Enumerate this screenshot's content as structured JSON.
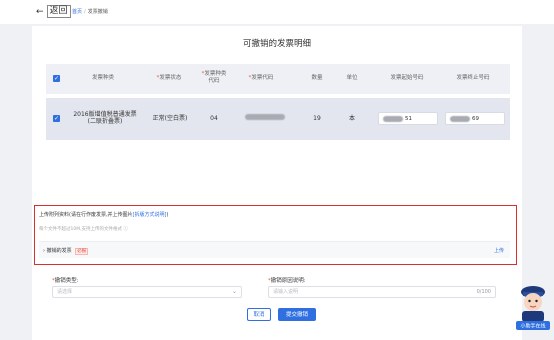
{
  "header": {
    "back_label": "返回",
    "back_arrow": "←",
    "breadcrumb_home": "首页",
    "breadcrumb_sep": "/",
    "breadcrumb_current": "发票撤销"
  },
  "page_title": "可撤销的发票明细",
  "table": {
    "headers": {
      "type": "发票种类",
      "status": "发票状态",
      "type_code": "发票种类代码",
      "invoice_code": "发票代码",
      "quantity": "数量",
      "unit": "单位",
      "start_no": "发票起始号码",
      "end_no": "发票终止号码"
    },
    "row": {
      "type": "2016版增值税普通发票(二联折叠票)",
      "status": "正常(空白票)",
      "type_code": "04",
      "quantity": "19",
      "unit": "本",
      "start_no_suffix": "51",
      "end_no_suffix": "69"
    }
  },
  "upload": {
    "title": "上传附列资料(请在行作废发票,并上传图片",
    "title_link": "[拆版方式说明]",
    "title_end": ")",
    "hint": "每个文件不超过10M,支持上传的文件格式",
    "item_label": "撤销的发票",
    "item_badge": "必报",
    "upload_button": "上传"
  },
  "form": {
    "type_label": "撤销类型:",
    "type_placeholder": "请选择",
    "reason_label": "撤销原因说明:",
    "reason_placeholder": "请输入说明",
    "reason_count": "0/100"
  },
  "buttons": {
    "cancel": "取消",
    "submit": "提交撤销"
  },
  "assistant_label": "小助手在线",
  "colors": {
    "primary": "#2f6fe0",
    "highlight_border": "#d63031",
    "required": "#e74c3c"
  }
}
